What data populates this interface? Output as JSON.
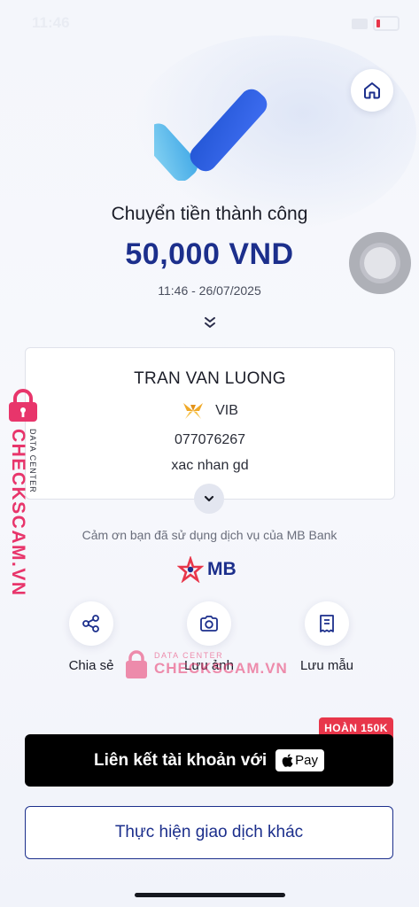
{
  "status_bar": {
    "time": "11:46"
  },
  "success": {
    "title": "Chuyển tiền thành công",
    "amount": "50,000 VND",
    "datetime": "11:46 - 26/07/2025"
  },
  "recipient": {
    "name": "TRAN VAN LUONG",
    "bank": "VIB",
    "account_number": "077076267",
    "note": "xac nhan gd"
  },
  "thanks_message": "Cảm ơn bạn đã sử dụng dịch vụ của MB Bank",
  "brand": {
    "logo_text": "MB",
    "color": "#1c2f8c",
    "accent": "#e8364a"
  },
  "actions": [
    {
      "label": "Chia sẻ",
      "icon": "share-icon"
    },
    {
      "label": "Lưu ảnh",
      "icon": "camera-icon"
    },
    {
      "label": "Lưu mẫu",
      "icon": "receipt-icon"
    }
  ],
  "apple_pay": {
    "label": "Liên kết tài khoản với",
    "badge": "Pay",
    "promo": "HOÀN 150K"
  },
  "other_transaction": {
    "label": "Thực hiện giao dịch khác"
  },
  "watermark": {
    "brand": "CHECKSCAM.VN",
    "sub": "DATA CENTER",
    "color": "#e8356b"
  }
}
